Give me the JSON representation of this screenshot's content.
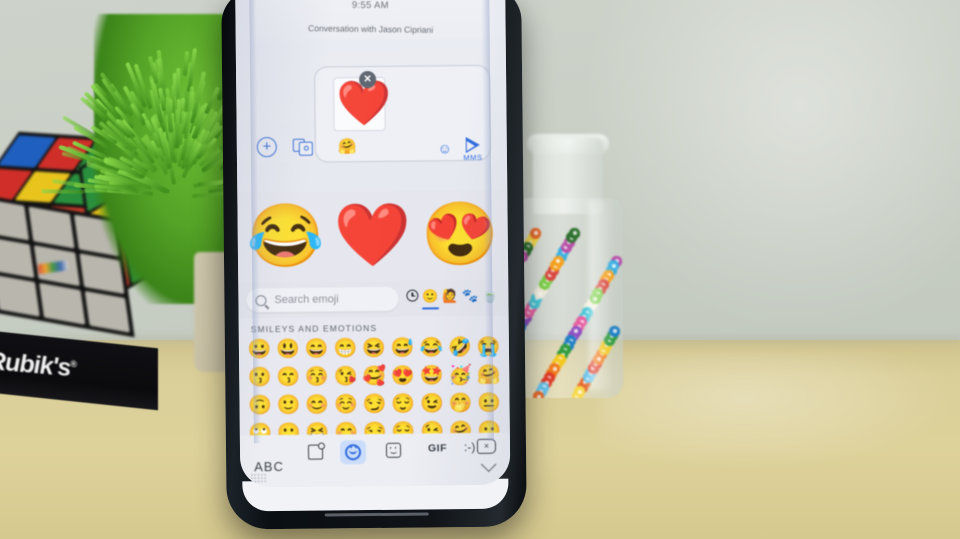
{
  "scene": {
    "description": "Smartphone on a desk showing an emoji keyboard in a messaging app",
    "wall_color": "#ccd2c8",
    "desk_color": "#ded29b"
  },
  "props": {
    "rubiks_cube": {
      "brand": "Rubik's",
      "trademark": "®"
    },
    "plant": {
      "label": "artificial grass plant"
    },
    "bead_jar": {
      "label": "glass jar of colorful beads"
    }
  },
  "phone": {
    "conversation": {
      "timestamp": "9:55 AM",
      "subject": "Conversation with Jason Cipriani",
      "compose": {
        "sticker": "❤️",
        "remove_label": "✕",
        "inline_emoji": "🤗",
        "emoji_button": "☺",
        "send_label": "MMS"
      },
      "attach_label": "+",
      "gallery_label": "gallery"
    },
    "suggestions": [
      "😂",
      "❤️",
      "😍"
    ],
    "search": {
      "placeholder": "Search emoji",
      "icon": "search-icon"
    },
    "categories": [
      {
        "name": "recent",
        "glyph": "clock-icon",
        "active": false
      },
      {
        "name": "smileys",
        "glyph": "🙂",
        "active": true
      },
      {
        "name": "people",
        "glyph": "🙋",
        "active": false
      },
      {
        "name": "animals",
        "glyph": "🐾",
        "active": false
      },
      {
        "name": "food",
        "glyph": "🍵",
        "active": false
      }
    ],
    "grid": {
      "section_title": "SMILEYS AND EMOTIONS",
      "rows": [
        [
          "😀",
          "😃",
          "😄",
          "😁",
          "😆",
          "😅",
          "😂",
          "🤣",
          "😭"
        ],
        [
          "😗",
          "😙",
          "😚",
          "😘",
          "🥰",
          "😍",
          "🤩",
          "🥳",
          "🤗"
        ],
        [
          "🙃",
          "🙂",
          "😊",
          "☺️",
          "😏",
          "😌",
          "😉",
          "🤭",
          "😐"
        ],
        [
          "🙄",
          "🙂",
          "😆",
          "😊",
          "😏",
          "😌",
          "😉",
          "🤗",
          "😶"
        ]
      ]
    },
    "keyboard_bar": {
      "abc_label": "ABC",
      "items": [
        {
          "name": "sticker-search",
          "label": ""
        },
        {
          "name": "emoji-tab",
          "label": "",
          "active": true
        },
        {
          "name": "sticker-tab",
          "label": ""
        },
        {
          "name": "gif-tab",
          "label": "GIF"
        },
        {
          "name": "emoticon-tab",
          "label": ":-)"
        },
        {
          "name": "backspace",
          "label": "×"
        }
      ],
      "collapse_label": "chevron-down"
    }
  },
  "colors": {
    "accent_blue": "#2f6bdd",
    "screen_bg": "#e8e9f0",
    "keyboard_bg": "#eceef3",
    "text_dark": "#3b4046",
    "text_muted": "#8b9098"
  }
}
